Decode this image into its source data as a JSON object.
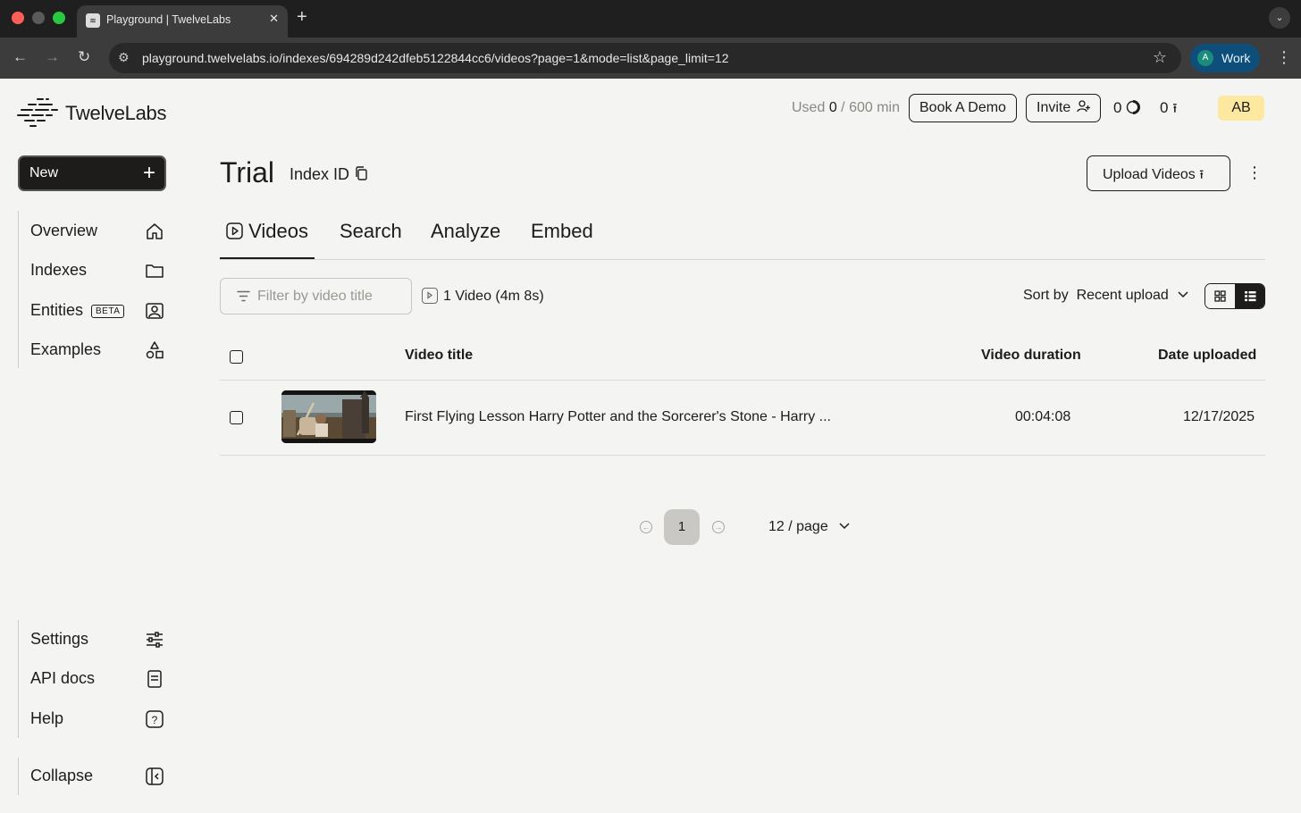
{
  "browser": {
    "tab_title": "Playground | TwelveLabs",
    "url": "playground.twelvelabs.io/indexes/694289d242dfeb5122844cc6/videos?page=1&mode=list&page_limit=12",
    "profile_initial": "A",
    "profile_label": "Work"
  },
  "header": {
    "brand": "TwelveLabs",
    "usage_prefix": "Used",
    "usage_used": "0",
    "usage_total": "/ 600 min",
    "book_demo": "Book A Demo",
    "invite": "Invite",
    "task_count": "0",
    "upload_count": "0",
    "user_initials": "AB"
  },
  "sidebar": {
    "new_label": "New",
    "items": [
      {
        "label": "Overview",
        "icon": "home-icon"
      },
      {
        "label": "Indexes",
        "icon": "folder-icon"
      },
      {
        "label": "Entities",
        "badge": "BETA",
        "icon": "person-card-icon"
      },
      {
        "label": "Examples",
        "icon": "shapes-icon"
      }
    ],
    "bottom_items": [
      {
        "label": "Settings",
        "icon": "sliders-icon"
      },
      {
        "label": "API docs",
        "icon": "document-icon"
      },
      {
        "label": "Help",
        "icon": "help-icon"
      }
    ],
    "collapse_label": "Collapse"
  },
  "main": {
    "title": "Trial",
    "index_id_label": "Index ID",
    "upload_label": "Upload Videos",
    "tabs": [
      "Videos",
      "Search",
      "Analyze",
      "Embed"
    ],
    "filter_placeholder": "Filter by video title",
    "video_count": "1 Video (4m 8s)",
    "sort_label": "Sort by",
    "sort_value": "Recent upload",
    "columns": {
      "title": "Video title",
      "duration": "Video duration",
      "date": "Date uploaded"
    },
    "rows": [
      {
        "title": "First Flying Lesson Harry Potter and the Sorcerer's Stone - Harry ...",
        "duration": "00:04:08",
        "date": "12/17/2025"
      }
    ],
    "pagination": {
      "current": "1",
      "page_size": "12 / page"
    }
  },
  "colors": {
    "accent_yellow": "#fde8a0",
    "ink": "#1d1c1b",
    "background": "#f4f4f2",
    "profile_blue": "#0d4f7a"
  }
}
